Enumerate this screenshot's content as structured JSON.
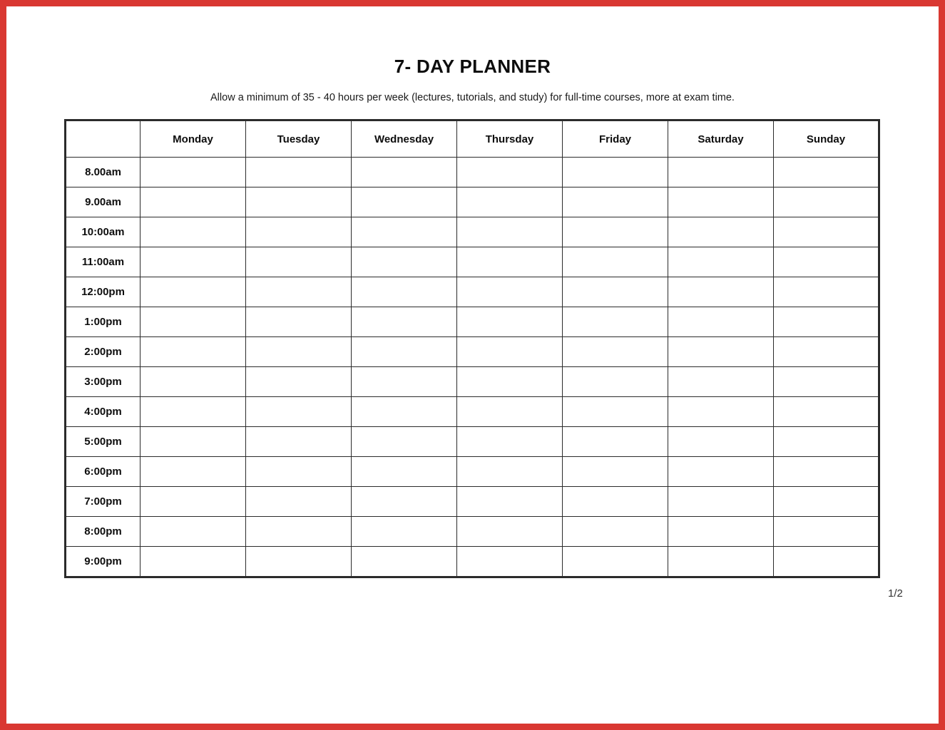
{
  "document": {
    "title": "7- DAY PLANNER",
    "subtitle": "Allow a minimum of 35 - 40 hours per week (lectures, tutorials, and study) for full-time courses, more at exam time.",
    "page_number": "1/2",
    "frame_color": "#d93832",
    "table_border_color": "#2b2b2b",
    "background_color": "#ffffff"
  },
  "table": {
    "corner_header": "",
    "day_headers": [
      "Monday",
      "Tuesday",
      "Wednesday",
      "Thursday",
      "Friday",
      "Saturday",
      "Sunday"
    ],
    "time_rows": [
      "8.00am",
      "9.00am",
      "10:00am",
      "11:00am",
      "12:00pm",
      "1:00pm",
      "2:00pm",
      "3:00pm",
      "4:00pm",
      "5:00pm",
      "6:00pm",
      "7:00pm",
      "8:00pm",
      "9:00pm"
    ],
    "cells": [
      [
        "",
        "",
        "",
        "",
        "",
        "",
        ""
      ],
      [
        "",
        "",
        "",
        "",
        "",
        "",
        ""
      ],
      [
        "",
        "",
        "",
        "",
        "",
        "",
        ""
      ],
      [
        "",
        "",
        "",
        "",
        "",
        "",
        ""
      ],
      [
        "",
        "",
        "",
        "",
        "",
        "",
        ""
      ],
      [
        "",
        "",
        "",
        "",
        "",
        "",
        ""
      ],
      [
        "",
        "",
        "",
        "",
        "",
        "",
        ""
      ],
      [
        "",
        "",
        "",
        "",
        "",
        "",
        ""
      ],
      [
        "",
        "",
        "",
        "",
        "",
        "",
        ""
      ],
      [
        "",
        "",
        "",
        "",
        "",
        "",
        ""
      ],
      [
        "",
        "",
        "",
        "",
        "",
        "",
        ""
      ],
      [
        "",
        "",
        "",
        "",
        "",
        "",
        ""
      ],
      [
        "",
        "",
        "",
        "",
        "",
        "",
        ""
      ],
      [
        "",
        "",
        "",
        "",
        "",
        "",
        ""
      ]
    ]
  }
}
